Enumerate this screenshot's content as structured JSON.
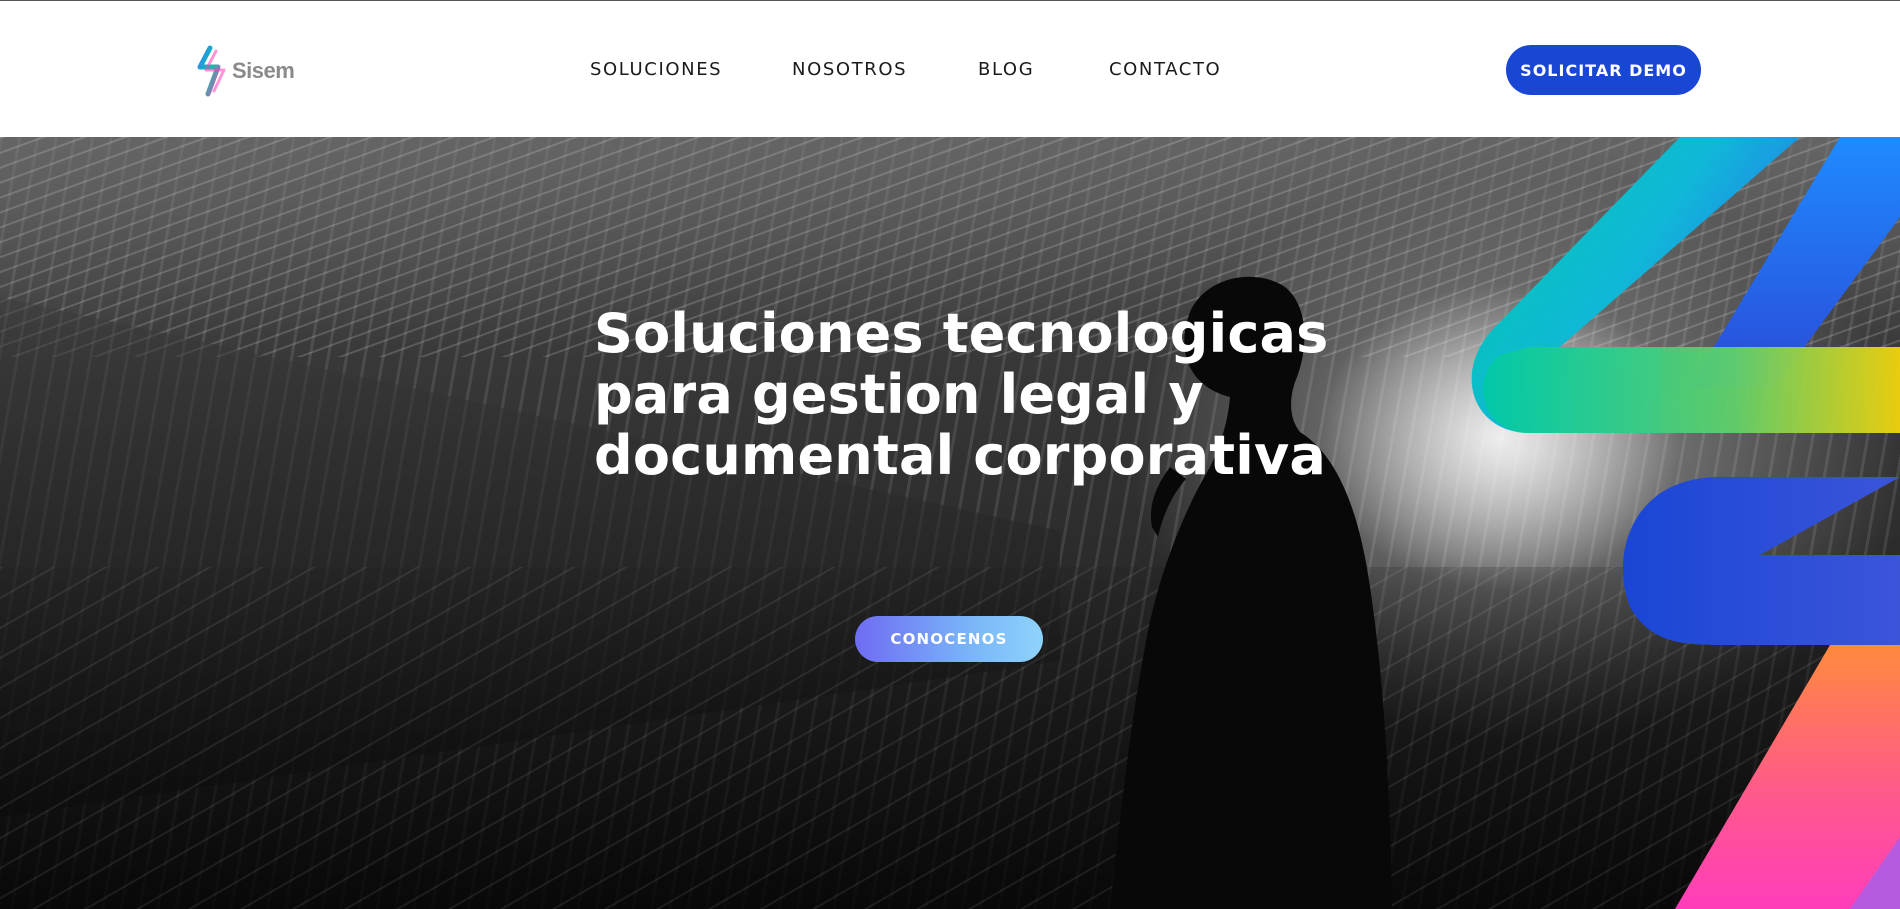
{
  "header": {
    "logo_text": "Sisem",
    "nav": [
      {
        "label": "SOLUCIONES"
      },
      {
        "label": "NOSOTROS"
      },
      {
        "label": "BLOG"
      },
      {
        "label": "CONTACTO"
      }
    ],
    "cta_label": "SOLICITAR DEMO"
  },
  "hero": {
    "title_lines": [
      "Soluciones tecnologicas",
      "para gestion legal y",
      "documental corporativa"
    ],
    "cta_label": "CONOCENOS"
  },
  "colors": {
    "primary_blue": "#1a46d6",
    "cta_gradient_start": "#6f6cf3",
    "cta_gradient_end": "#8ed3fb",
    "brand_teal": "#00c9a7",
    "brand_pink": "#ff3dbb",
    "brand_orange": "#ff8a3d",
    "brand_yellow": "#f2d40c"
  },
  "icons": {
    "logo": "sisem-bolt-logo-icon"
  }
}
